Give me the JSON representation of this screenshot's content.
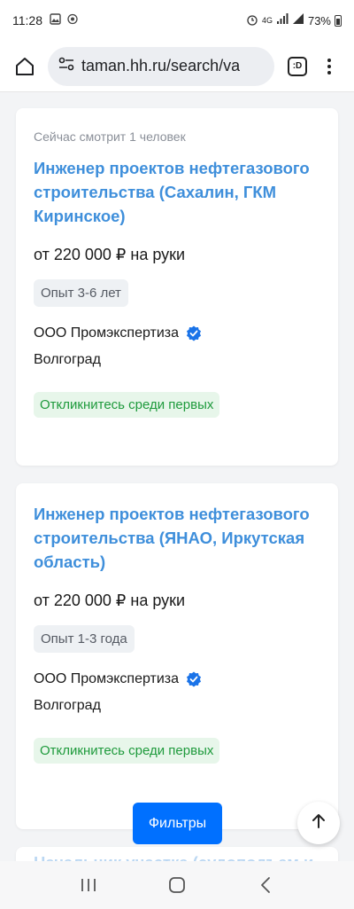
{
  "status_bar": {
    "time": "11:28",
    "network": "4G",
    "battery": "73%"
  },
  "browser": {
    "url": "taman.hh.ru/search/va",
    "tab_icon_label": ":D",
    "icons": [
      "home-icon",
      "site-settings-icon",
      "tab-switcher-icon",
      "more-menu-icon"
    ]
  },
  "vacancies": [
    {
      "viewers": "Сейчас смотрит 1 человек",
      "title": "Инженер проектов нефтегазового строительства (Сахалин, ГКМ Киринское)",
      "salary": "от 220 000 ₽ на руки",
      "experience": "Опыт 3-6 лет",
      "company": "ООО Промэкспертиза",
      "city": "Волгоград",
      "badge": "Откликнитесь среди первых"
    },
    {
      "title": "Инженер проектов нефтегазового строительства (ЯНАО, Иркутская область)",
      "salary": "от 220 000 ₽ на руки",
      "experience": "Опыт 1-3 года",
      "company": "ООО Промэкспертиза",
      "city": "Волгоград",
      "badge": "Откликнитесь среди первых"
    },
    {
      "title": "Начальник участка (судоподъем и"
    }
  ],
  "filters_button": "Фильтры",
  "colors": {
    "link": "#3f8fdb",
    "primary": "#0070ff",
    "badge_bg": "#e7f6ea",
    "badge_text": "#1e9a3c",
    "verified": "#1a73e8"
  },
  "nav_bar": {
    "icons": [
      "recent-apps-icon",
      "home-nav-icon",
      "back-icon"
    ]
  }
}
